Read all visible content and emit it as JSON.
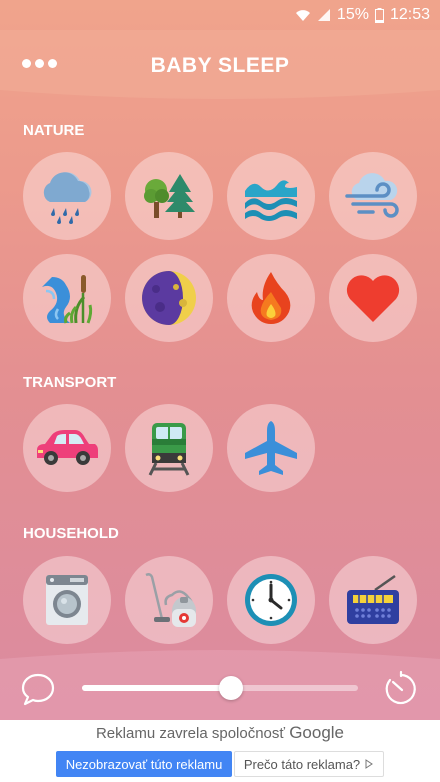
{
  "status_bar": {
    "battery": "15%",
    "time": "12:53"
  },
  "header": {
    "title": "BABY SLEEP",
    "menu_icon": "more-dots-icon"
  },
  "sections": [
    {
      "title": "NATURE",
      "sounds": [
        {
          "icon": "rain-cloud-icon"
        },
        {
          "icon": "forest-icon"
        },
        {
          "icon": "waves-icon"
        },
        {
          "icon": "wind-icon"
        },
        {
          "icon": "stream-icon"
        },
        {
          "icon": "moon-icon"
        },
        {
          "icon": "fire-icon"
        },
        {
          "icon": "heart-icon"
        }
      ]
    },
    {
      "title": "TRANSPORT",
      "sounds": [
        {
          "icon": "car-icon"
        },
        {
          "icon": "train-icon"
        },
        {
          "icon": "airplane-icon"
        }
      ]
    },
    {
      "title": "HOUSEHOLD",
      "sounds": [
        {
          "icon": "washing-machine-icon"
        },
        {
          "icon": "vacuum-cleaner-icon"
        },
        {
          "icon": "clock-icon"
        },
        {
          "icon": "radio-icon"
        }
      ]
    }
  ],
  "volume": {
    "level": 0.54
  },
  "controls": {
    "left_icon": "chat-bubble-icon",
    "right_icon": "timer-icon"
  },
  "ad": {
    "closed_text": "Reklamu zavrela spoločnosť",
    "brand": "Google",
    "hide_button": "Nezobrazovať túto reklamu",
    "why_button": "Prečo táto reklama?",
    "why_icon": "play-outline-icon"
  },
  "colors": {
    "background_top": "#f0a48c",
    "background_bottom": "#db8ba0",
    "ad_button": "#4285f4"
  }
}
